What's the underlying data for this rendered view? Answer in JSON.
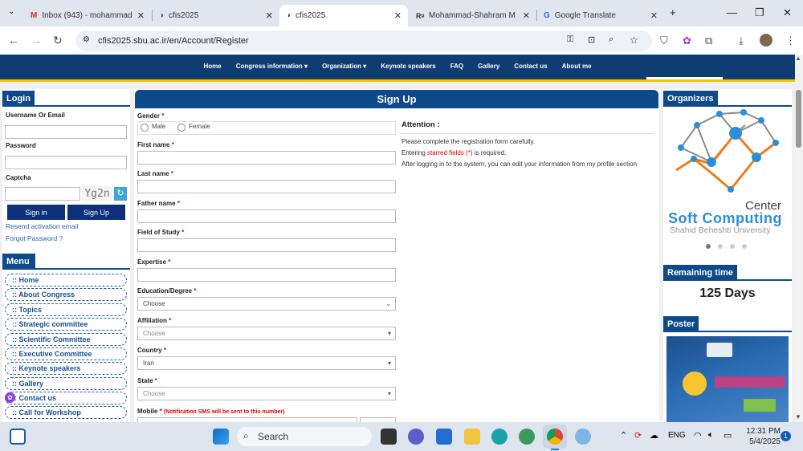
{
  "browser": {
    "tabs": [
      {
        "title": "Inbox (943) - mohammad",
        "icon": "gmail-icon"
      },
      {
        "title": "cfis2025",
        "icon": "site-icon"
      },
      {
        "title": "cfis2025",
        "icon": "site-icon"
      },
      {
        "title": "Mohammad-Shahram M",
        "icon": "researchgate-icon"
      },
      {
        "title": "Google Translate",
        "icon": "translate-icon"
      }
    ],
    "url": "cfis2025.sbu.ac.ir/en/Account/Register"
  },
  "nav": [
    "Home",
    "Congress information",
    "Organization",
    "Keynote speakers",
    "FAQ",
    "Gallery",
    "Contact us",
    "About me"
  ],
  "login": {
    "title": "Login",
    "username_label": "Username Or Email",
    "password_label": "Password",
    "captcha_label": "Captcha",
    "captcha_text": "Yg2n",
    "signin": "Sign in",
    "signup": "Sign Up",
    "resend": "Resend activation email",
    "forgot": "Forgot Password ?"
  },
  "menu": {
    "title": "Menu",
    "items": [
      ":: Home",
      ":: About Congress",
      ":: Topics",
      ":: Strategic committee",
      ":: Scientific Committee",
      ":: Executive Committee",
      ":: Keynote speakers",
      ":: Gallery",
      ":: Contact us",
      ":: Call for Workshop"
    ]
  },
  "form": {
    "title": "Sign Up",
    "gender_label": "Gender",
    "male": "Male",
    "female": "Female",
    "first_name": "First name",
    "last_name": "Last name",
    "father_name": "Father name",
    "field_of_study": "Field of Study",
    "expertise": "Expertise",
    "education_label": "Education/Degree",
    "education_value": "Choose",
    "affiliation_label": "Affiliation",
    "affiliation_value": "Choose",
    "country_label": "Country",
    "country_value": "Iran",
    "state_label": "State",
    "state_value": "Choose",
    "mobile_label": "Mobile",
    "mobile_note": "(Notification SMS will be sent to this number)",
    "req_mark": "*"
  },
  "attention": {
    "title": "Attention :",
    "line1": "Please complete the registration form carefully.",
    "line2_pre": "Entering ",
    "line2_red": "starred fields (*)",
    "line2_post": " is required.",
    "line3": "After logging in to the system, you can edit your information from my profile section"
  },
  "organizers": {
    "title": "Organizers",
    "center": "Center",
    "soft": "Soft Computing",
    "univ": "Shahid Beheshti University"
  },
  "remaining": {
    "title": "Remaining time",
    "value": "125 Days"
  },
  "poster": {
    "title": "Poster"
  },
  "taskbar": {
    "search": "Search",
    "lang": "ENG",
    "time": "12:31 PM",
    "date": "5/4/2025",
    "badge": "1"
  },
  "colors": {
    "brand": "#0e4a8a",
    "nav": "#0e3c73",
    "accent": "#f4c400",
    "required": "#dd0000"
  }
}
